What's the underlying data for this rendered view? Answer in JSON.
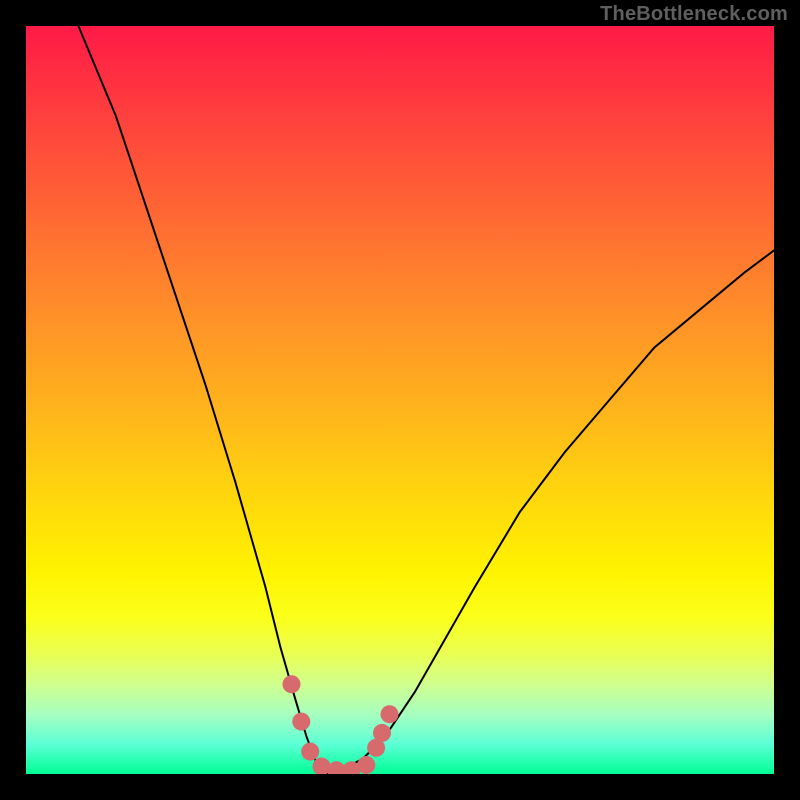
{
  "watermark": "TheBottleneck.com",
  "chart_data": {
    "type": "line",
    "title": "",
    "xlabel": "",
    "ylabel": "",
    "xlim": [
      0,
      100
    ],
    "ylim": [
      0,
      100
    ],
    "grid": false,
    "series": [
      {
        "name": "bottleneck-curve",
        "x": [
          7,
          12,
          16,
          20,
          24,
          28,
          32,
          34,
          36,
          37.5,
          39,
          40,
          41,
          42,
          45,
          48,
          52,
          56,
          60,
          66,
          72,
          78,
          84,
          90,
          96,
          100
        ],
        "y": [
          100,
          88,
          76,
          64,
          52,
          39,
          25,
          17,
          10,
          5,
          1,
          0,
          0,
          0.5,
          2,
          5,
          11,
          18,
          25,
          35,
          43,
          50,
          57,
          62,
          67,
          70
        ]
      }
    ],
    "markers": {
      "name": "highlight-dots",
      "color": "#d76a6d",
      "points_xy": [
        [
          35.5,
          12
        ],
        [
          36.8,
          7
        ],
        [
          38.0,
          3
        ],
        [
          39.5,
          1
        ],
        [
          41.5,
          0.5
        ],
        [
          43.5,
          0.5
        ],
        [
          45.5,
          1.2
        ],
        [
          46.8,
          3.5
        ],
        [
          47.6,
          5.5
        ],
        [
          48.6,
          8
        ]
      ]
    },
    "background_gradient": {
      "top": "#ff1a47",
      "mid": "#fff300",
      "bottom": "#00ff94"
    }
  }
}
